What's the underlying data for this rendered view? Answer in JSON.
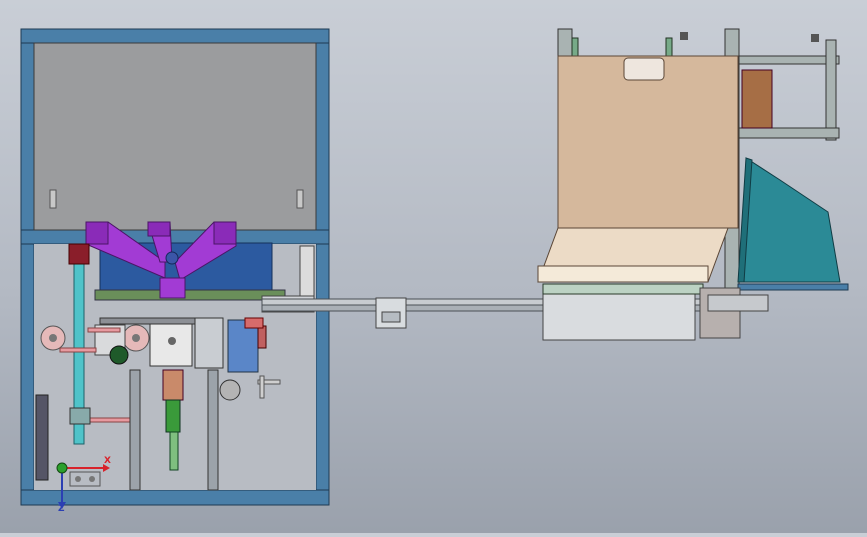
{
  "viewport": {
    "background_top": "#c9ced6",
    "background_bottom": "#9aa1ac"
  },
  "triad": {
    "x_label": "X",
    "z_label": "Z",
    "x_color": "#d8222a",
    "y_color": "#2ca02c",
    "z_color": "#2b3fb3"
  },
  "colors": {
    "frame_blue": "#4a7fa8",
    "hopper_purple": "#a23bd4",
    "drum_blue": "#2c5aa0",
    "panel_tan": "#d5b89c",
    "chute_teal": "#2b8a96",
    "rail_gray": "#c8ccd0",
    "shaft_cyan": "#4fc3c9"
  },
  "model": {
    "left_machine": "cabinet-assembly",
    "right_machine": "tray-feeder-assembly",
    "connector": "conveyor-rail"
  }
}
